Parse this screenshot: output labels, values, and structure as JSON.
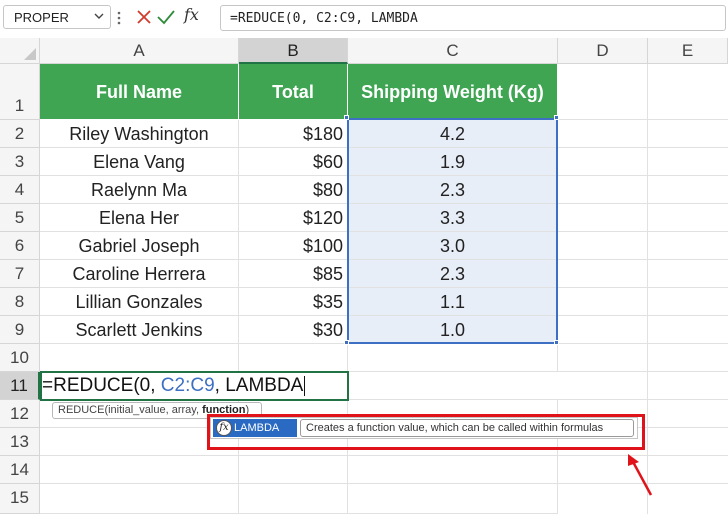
{
  "formula_bar": {
    "name_box": "PROPER",
    "fx_label": "fx",
    "formula": "=REDUCE(0, C2:C9, LAMBDA"
  },
  "columns": [
    "A",
    "B",
    "C",
    "D",
    "E"
  ],
  "selected_column": "B",
  "rows": [
    "1",
    "2",
    "3",
    "4",
    "5",
    "6",
    "7",
    "8",
    "9",
    "10",
    "11",
    "12",
    "13",
    "14",
    "15"
  ],
  "selected_row": "11",
  "table": {
    "headers": [
      "Full Name",
      "Total",
      "Shipping Weight (Kg)"
    ],
    "records": [
      {
        "name": "Riley Washington",
        "total": "$180",
        "weight": "4.2"
      },
      {
        "name": "Elena Vang",
        "total": "$60",
        "weight": "1.9"
      },
      {
        "name": "Raelynn Ma",
        "total": "$80",
        "weight": "2.3"
      },
      {
        "name": "Elena Her",
        "total": "$120",
        "weight": "3.3"
      },
      {
        "name": "Gabriel Joseph",
        "total": "$100",
        "weight": "3.0"
      },
      {
        "name": "Caroline Herrera",
        "total": "$85",
        "weight": "2.3"
      },
      {
        "name": "Lillian Gonzales",
        "total": "$35",
        "weight": "1.1"
      },
      {
        "name": "Scarlett Jenkins",
        "total": "$30",
        "weight": "1.0"
      }
    ]
  },
  "edit_cell": {
    "prefix": "=REDUCE(0, ",
    "range_ref": "C2:C9",
    "suffix": ", LAMBDA"
  },
  "syntax_tooltip": {
    "text": "REDUCE(initial_value, array, ",
    "bold_arg": "function",
    "close": ")"
  },
  "autocomplete": {
    "item": "LAMBDA",
    "icon_glyph": "fx",
    "description": "Creates a function value, which can be called within formulas"
  },
  "colors": {
    "header_green": "#3fa553",
    "selection_blue": "#3d6fc2",
    "highlight_red": "#e0131a",
    "excel_green": "#217346"
  }
}
